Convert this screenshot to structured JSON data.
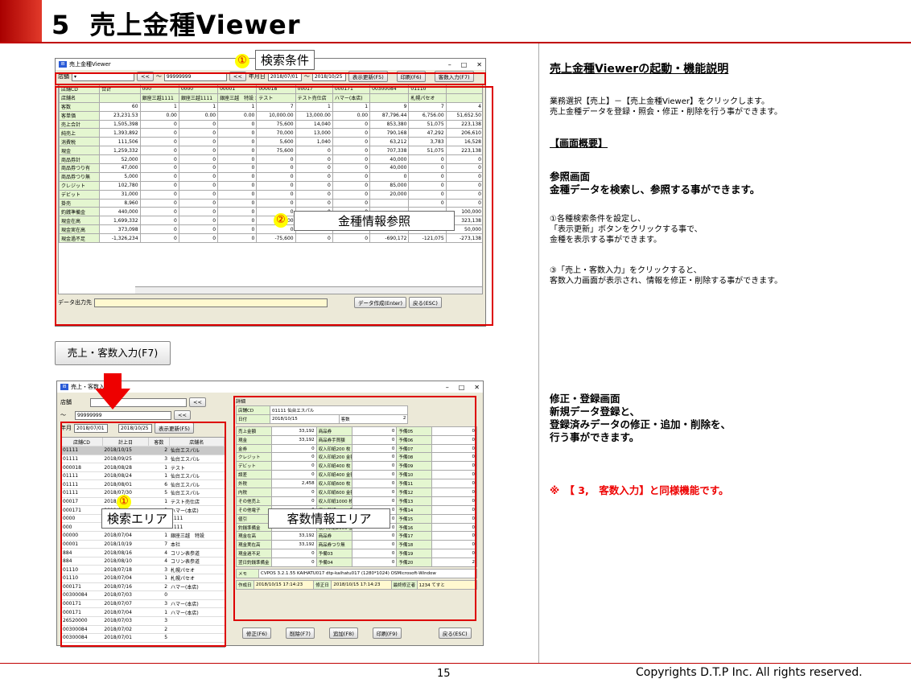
{
  "slide": {
    "number": "5",
    "title": "売上金種Viewer",
    "page": "15",
    "copyright": "Copyrights D.T.P Inc. All rights reserved."
  },
  "callouts": {
    "c1_num": "①",
    "c1": "検索条件",
    "c2_num": "②",
    "c2": "金種情報参照",
    "c3_num": "①",
    "c3": "検索エリア",
    "c4": "客数情報エリア",
    "button_label": "売上・客数入力(F7)"
  },
  "right": {
    "heading": "売上金種Viewerの起動・機能説明",
    "intro1": "業務選択【売上】－【売上金種Viewer】をクリックします。",
    "intro2": "売上金種データを登録・照会・修正・削除を行う事ができます。",
    "overview": "【画面概要】",
    "ref_title": "参照画面",
    "ref_desc": "金種データを検索し、参照する事ができます。",
    "s1a": "①各種検索条件を設定し、",
    "s1b": "「表示更新」ボタンをクリックする事で、",
    "s1c": "金種を表示する事ができます。",
    "s3a": "③「売上・客数入力」をクリックすると、",
    "s3b": "客数入力画面が表示され、情報を修正・削除する事ができます。",
    "edit_title": "修正・登録画面",
    "edit1": "新規データ登録と、",
    "edit2": "登録済みデータの修正・追加・削除を、",
    "edit3": "行う事ができます。",
    "note": "※　【 3,　客数入力】と同様機能です。"
  },
  "win1": {
    "title": "売上金種Viewer",
    "store_label": "店舗",
    "tilde": "～",
    "store_to": "99999999",
    "ym_label": "年月日",
    "date_from": "2018/07/01",
    "date_to": "2018/10/25",
    "btn_refresh": "表示更新(F5)",
    "btn_print": "印刷(F6)",
    "btn_input": "客数入力(F7)",
    "columns": [
      "店舗CD",
      "合計",
      "000",
      "0000",
      "00001",
      "000018",
      "00017",
      "000171",
      "00300084",
      "01110"
    ],
    "names": [
      "店舗名",
      "",
      "銀座三越1111",
      "銀座三越1111",
      "銀座三越　特設 本社",
      "テスト",
      "テスト売仕店",
      "ハマー(本店)",
      "",
      "札幌パセオ"
    ],
    "rows": [
      [
        "客数",
        "60",
        "1",
        "1",
        "1",
        "7",
        "1",
        "1",
        "9",
        "7",
        "4"
      ],
      [
        "客単価",
        "23,231.53",
        "0.00",
        "0.00",
        "0.00",
        "10,000.00",
        "13,000.00",
        "0.00",
        "87,796.44",
        "6,756.00",
        "51,652.50"
      ],
      [
        "売上合計",
        "1,505,398",
        "0",
        "0",
        "0",
        "75,600",
        "14,040",
        "0",
        "853,380",
        "51,075",
        "223,138"
      ],
      [
        "純売上",
        "1,393,892",
        "0",
        "0",
        "0",
        "70,000",
        "13,000",
        "0",
        "790,168",
        "47,292",
        "206,610"
      ],
      [
        "消費税",
        "111,506",
        "0",
        "0",
        "0",
        "5,600",
        "1,040",
        "0",
        "63,212",
        "3,783",
        "16,528"
      ],
      [
        "現金",
        "1,259,332",
        "0",
        "0",
        "0",
        "75,600",
        "0",
        "0",
        "707,338",
        "51,075",
        "223,138"
      ],
      [
        "商品券計",
        "52,000",
        "0",
        "0",
        "0",
        "0",
        "0",
        "0",
        "40,000",
        "0",
        "0"
      ],
      [
        "商品券つり有",
        "47,000",
        "0",
        "0",
        "0",
        "0",
        "0",
        "0",
        "40,000",
        "0",
        "0"
      ],
      [
        "商品券つり無",
        "5,000",
        "0",
        "0",
        "0",
        "0",
        "0",
        "0",
        "0",
        "0",
        "0"
      ],
      [
        "クレジット",
        "102,780",
        "0",
        "0",
        "0",
        "0",
        "0",
        "0",
        "85,000",
        "0",
        "0"
      ],
      [
        "デビット",
        "31,000",
        "0",
        "0",
        "0",
        "0",
        "0",
        "0",
        "20,000",
        "0",
        "0"
      ],
      [
        "掛売",
        "8,960",
        "0",
        "0",
        "0",
        "0",
        "0",
        "0",
        "",
        "0",
        "0"
      ],
      [
        "釣銭準備金",
        "440,000",
        "0",
        "0",
        "0",
        "0",
        "0",
        "0",
        "",
        "",
        "100,000"
      ],
      [
        "現金在高",
        "1,699,332",
        "0",
        "0",
        "0",
        "75,600",
        "0",
        "0",
        "807,338",
        "201,075",
        "323,138"
      ],
      [
        "現金実在高",
        "373,098",
        "0",
        "0",
        "0",
        "0",
        "0",
        "0",
        "117,166",
        "80,000",
        "50,000"
      ],
      [
        "現金過不足",
        "-1,326,234",
        "0",
        "0",
        "0",
        "-75,600",
        "0",
        "0",
        "-690,172",
        "-121,075",
        "-273,138"
      ]
    ],
    "out_label": "データ出力先",
    "btn_create": "データ作成(Enter)",
    "btn_back": "戻る(ESC)"
  },
  "win2": {
    "title": "売上・客数入力",
    "store_label": "店舗",
    "tilde": "～",
    "store_to": "99999999",
    "ym_label": "年月",
    "date_from": "2018/07/01",
    "date_to": "2018/10/25",
    "btn_refresh": "表示更新(F5)",
    "list_head": [
      "店舗CD",
      "計上日",
      "客数",
      "店舗名"
    ],
    "list": [
      [
        "01111",
        "2018/10/15",
        "2",
        "仙台エスパル"
      ],
      [
        "01111",
        "2018/09/25",
        "3",
        "仙台エスパル"
      ],
      [
        "000018",
        "2018/08/28",
        "1",
        "テスト"
      ],
      [
        "01111",
        "2018/08/24",
        "1",
        "仙台エスパル"
      ],
      [
        "01111",
        "2018/08/01",
        "6",
        "仙台エスパル"
      ],
      [
        "01111",
        "2018/07/30",
        "5",
        "仙台エスパル"
      ],
      [
        "00017",
        "2018/0",
        "1",
        "テスト売仕店"
      ],
      [
        "000171",
        "2018/0",
        "3",
        "ハマー(本店)"
      ],
      [
        "0000",
        "2",
        "",
        "1111"
      ],
      [
        "000",
        "",
        "",
        "1111"
      ],
      [
        "00000",
        "2018/07/04",
        "1",
        "銀座三越　特設"
      ],
      [
        "00001",
        "2018/10/19",
        "7",
        "本社"
      ],
      [
        "884",
        "2018/08/16",
        "4",
        "コリン表参道"
      ],
      [
        "884",
        "2018/08/10",
        "4",
        "コリン表参道"
      ],
      [
        "01110",
        "2018/07/18",
        "3",
        "札幌パセオ"
      ],
      [
        "01110",
        "2018/07/04",
        "1",
        "札幌パセオ"
      ],
      [
        "000171",
        "2018/07/16",
        "2",
        "ハマー(本店)"
      ],
      [
        "00300084",
        "2018/07/03",
        "0",
        ""
      ],
      [
        "000171",
        "2018/07/07",
        "3",
        "ハマー(本店)"
      ],
      [
        "000171",
        "2018/07/04",
        "1",
        "ハマー(本店)"
      ],
      [
        "26520000",
        "2018/07/03",
        "3",
        ""
      ],
      [
        "00300084",
        "2018/07/02",
        "2",
        ""
      ],
      [
        "00300084",
        "2018/07/01",
        "5",
        ""
      ]
    ],
    "detail_label": "詳細",
    "store_cd_label": "店舗CD",
    "store_cd": "01111 仙台エスパル",
    "date_label": "日付",
    "date": "2018/10/15",
    "count_label": "客数",
    "count": "2",
    "fields": [
      [
        "売上金額",
        "33,192",
        "商品券",
        "0",
        "予備05",
        "0"
      ],
      [
        "現金",
        "33,192",
        "商品券手買額",
        "0",
        "予備06",
        "0"
      ],
      [
        "金券",
        "0",
        "収入印紙200 枚",
        "0",
        "予備07",
        "0"
      ],
      [
        "クレジット",
        "0",
        "収入印紙200 金額",
        "0",
        "予備08",
        "0"
      ],
      [
        "デビット",
        "0",
        "収入印紙400 枚",
        "0",
        "予備09",
        "0"
      ],
      [
        "誤差",
        "0",
        "収入印紙400 金額",
        "0",
        "予備10",
        "0"
      ],
      [
        "外税",
        "2,458",
        "収入印紙600 枚",
        "0",
        "予備11",
        "0"
      ],
      [
        "内税",
        "0",
        "収入印紙600 金額",
        "0",
        "予備12",
        "0"
      ],
      [
        "その他売上",
        "0",
        "収入印紙1000 枚",
        "0",
        "予備13",
        "0"
      ],
      [
        "その他電子",
        "0",
        "収入印紙1000 金額",
        "0",
        "予備14",
        "0"
      ],
      [
        "値引",
        "0",
        "収入印紙2000 枚",
        "0",
        "予備15",
        "0"
      ],
      [
        "釣銭準備金",
        "0",
        "収入印紙2000 金額",
        "0",
        "予備16",
        "0"
      ],
      [
        "現金在高",
        "33,192",
        "商品券",
        "0",
        "予備17",
        "0"
      ],
      [
        "現金実在高",
        "33,192",
        "商品券つり無",
        "0",
        "予備18",
        "0"
      ],
      [
        "現金過不足",
        "0",
        "予備03",
        "0",
        "予備19",
        "0"
      ],
      [
        "翌日釣銭準備金",
        "0",
        "予備04",
        "0",
        "予備20",
        "2"
      ]
    ],
    "memo_label": "メモ",
    "memo": "CVPOS 3.2.1.55 KAIHATU017 dtp-kaihatu017 (1280*1024) OSMicrosoft-Window",
    "created_label": "作成日",
    "created": "2018/10/15 17:14:23",
    "modified_label": "修正日",
    "modified": "2018/10/15 17:14:23",
    "editor_label": "最終修正者",
    "editor": "1234 てすと",
    "btns": [
      "修正(F6)",
      "削除(F7)",
      "追加(F8)",
      "印刷(F9)",
      "戻る(ESC)"
    ]
  },
  "colors": {
    "accent": "#c00000",
    "highlight": "#dd0000",
    "grid_header": "#e4f6d0"
  }
}
